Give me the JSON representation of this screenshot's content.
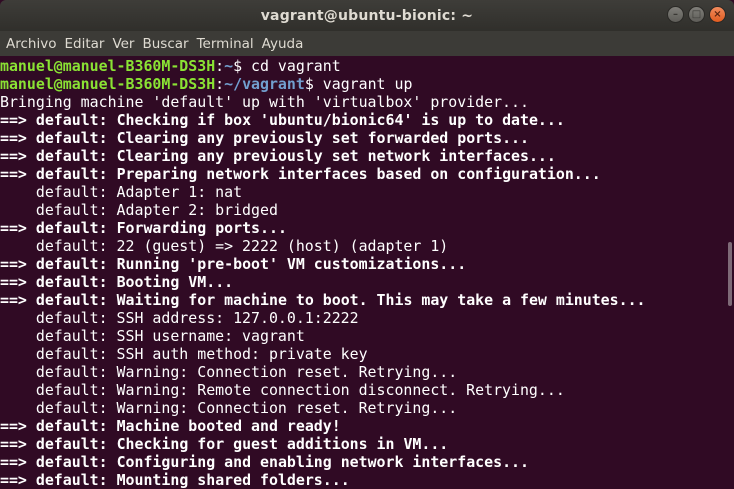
{
  "window": {
    "title": "vagrant@ubuntu-bionic: ~",
    "controls": {
      "minimize": "–",
      "maximize": "□",
      "close": "×"
    }
  },
  "menu": [
    "Archivo",
    "Editar",
    "Ver",
    "Buscar",
    "Terminal",
    "Ayuda"
  ],
  "prompt1": {
    "user_host": "manuel@manuel-B360M-DS3H",
    "path": "~",
    "cmd": "$ cd vagrant"
  },
  "prompt2": {
    "user_host": "manuel@manuel-B360M-DS3H",
    "path": "~/vagrant",
    "cmd": "$ vagrant up"
  },
  "lines": [
    {
      "arrow": "",
      "label": "",
      "text": "Bringing machine 'default' up with 'virtualbox' provider..."
    },
    {
      "arrow": "==> ",
      "label": "default:",
      "text": " Checking if box 'ubuntu/bionic64' is up to date..."
    },
    {
      "arrow": "==> ",
      "label": "default:",
      "text": " Clearing any previously set forwarded ports..."
    },
    {
      "arrow": "==> ",
      "label": "default:",
      "text": " Clearing any previously set network interfaces..."
    },
    {
      "arrow": "==> ",
      "label": "default:",
      "text": " Preparing network interfaces based on configuration..."
    },
    {
      "arrow": "",
      "label": "",
      "text": "    default: Adapter 1: nat"
    },
    {
      "arrow": "",
      "label": "",
      "text": "    default: Adapter 2: bridged"
    },
    {
      "arrow": "==> ",
      "label": "default:",
      "text": " Forwarding ports..."
    },
    {
      "arrow": "",
      "label": "",
      "text": "    default: 22 (guest) => 2222 (host) (adapter 1)"
    },
    {
      "arrow": "==> ",
      "label": "default:",
      "text": " Running 'pre-boot' VM customizations..."
    },
    {
      "arrow": "==> ",
      "label": "default:",
      "text": " Booting VM..."
    },
    {
      "arrow": "==> ",
      "label": "default:",
      "text": " Waiting for machine to boot. This may take a few minutes..."
    },
    {
      "arrow": "",
      "label": "",
      "text": "    default: SSH address: 127.0.0.1:2222"
    },
    {
      "arrow": "",
      "label": "",
      "text": "    default: SSH username: vagrant"
    },
    {
      "arrow": "",
      "label": "",
      "text": "    default: SSH auth method: private key"
    },
    {
      "arrow": "",
      "label": "",
      "text": "    default: Warning: Connection reset. Retrying..."
    },
    {
      "arrow": "",
      "label": "",
      "text": "    default: Warning: Remote connection disconnect. Retrying..."
    },
    {
      "arrow": "",
      "label": "",
      "text": "    default: Warning: Connection reset. Retrying..."
    },
    {
      "arrow": "==> ",
      "label": "default:",
      "text": " Machine booted and ready!"
    },
    {
      "arrow": "==> ",
      "label": "default:",
      "text": " Checking for guest additions in VM..."
    },
    {
      "arrow": "==> ",
      "label": "default:",
      "text": " Configuring and enabling network interfaces..."
    },
    {
      "arrow": "==> ",
      "label": "default:",
      "text": " Mounting shared folders..."
    }
  ],
  "colors": {
    "background": "#300a24",
    "prompt_user": "#8ae234",
    "prompt_path": "#729fcf"
  }
}
